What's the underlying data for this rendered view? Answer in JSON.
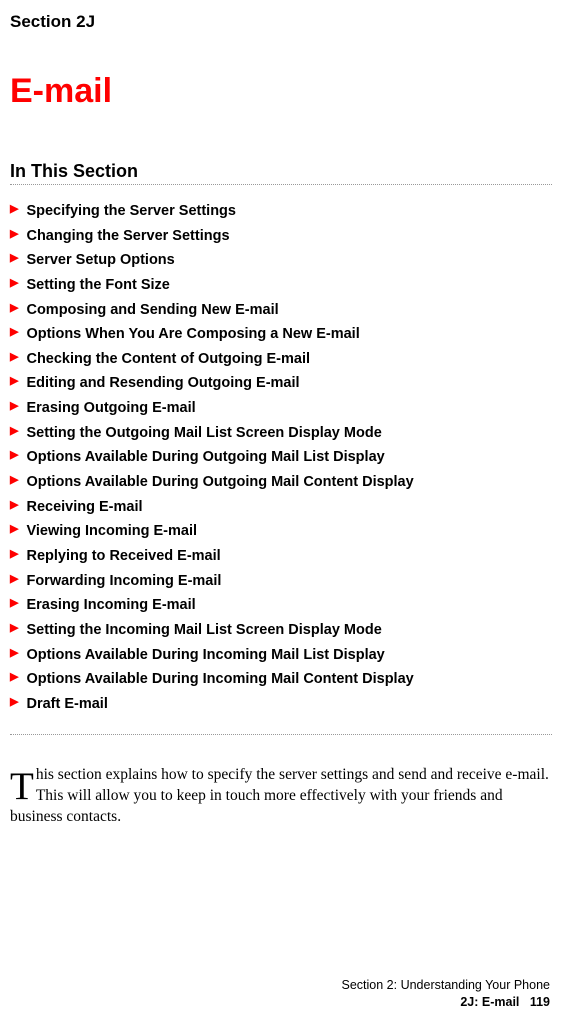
{
  "header": {
    "section_label": "Section 2J",
    "main_title": "E-mail"
  },
  "subsection": {
    "title": "In This Section"
  },
  "items": [
    "Specifying the Server Settings",
    "Changing the Server Settings",
    "Server Setup Options",
    "Setting the Font Size",
    "Composing and Sending New E-mail",
    "Options When You Are Composing a New E-mail",
    "Checking the Content of Outgoing E-mail",
    "Editing and Resending Outgoing E-mail",
    "Erasing Outgoing E-mail",
    "Setting the Outgoing Mail List Screen Display Mode",
    "Options Available During Outgoing Mail List Display",
    "Options Available During Outgoing Mail Content Display",
    "Receiving E-mail",
    "Viewing Incoming E-mail",
    "Replying to Received E-mail",
    "Forwarding Incoming E-mail",
    "Erasing Incoming E-mail",
    "Setting the Incoming Mail List Screen Display Mode",
    "Options Available During Incoming Mail List Display",
    "Options Available During Incoming Mail Content Display",
    "Draft E-mail"
  ],
  "intro": {
    "drop_cap": "T",
    "text": "his section explains how to specify the server settings and send and receive e-mail. This will allow you to keep in touch more effectively with your friends and business contacts."
  },
  "footer": {
    "line1": "Section 2: Understanding Your Phone",
    "line2_prefix": "2J: E-mail",
    "page_number": "119"
  }
}
